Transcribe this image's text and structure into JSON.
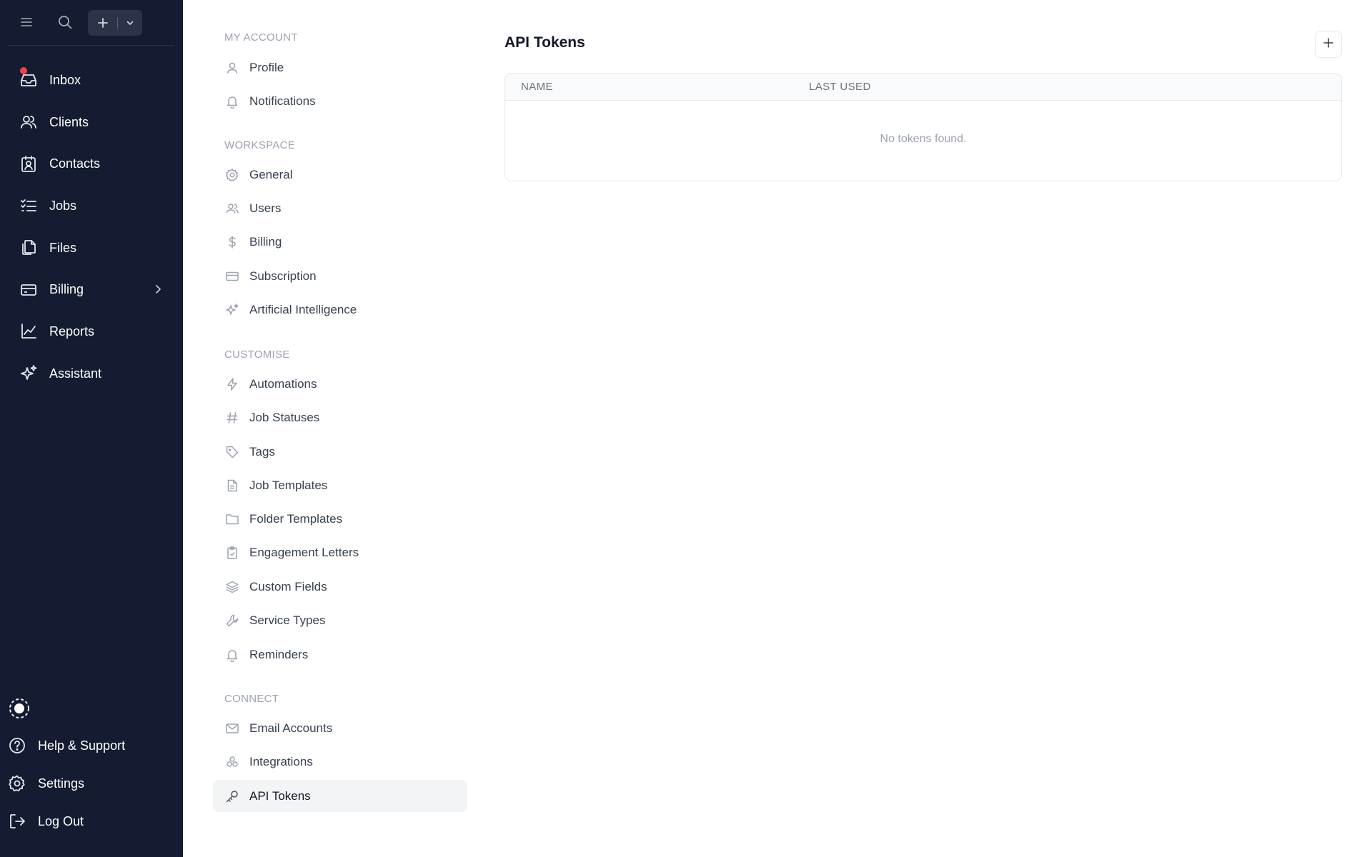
{
  "topbar": {
    "menu_icon": "menu-icon",
    "search_icon": "search-icon",
    "new_button_icon": "plus-icon",
    "new_dropdown_icon": "chevron-down-icon"
  },
  "main_nav": [
    {
      "label": "Inbox",
      "icon": "inbox-icon",
      "badge": true
    },
    {
      "label": "Clients",
      "icon": "users-icon"
    },
    {
      "label": "Contacts",
      "icon": "contact-card-icon"
    },
    {
      "label": "Jobs",
      "icon": "checklist-icon"
    },
    {
      "label": "Files",
      "icon": "files-icon"
    },
    {
      "label": "Billing",
      "icon": "credit-card-icon",
      "expandable": true
    },
    {
      "label": "Reports",
      "icon": "line-chart-icon"
    },
    {
      "label": "Assistant",
      "icon": "sparkles-icon"
    }
  ],
  "bottom_nav": {
    "help": "Help & Support",
    "settings": "Settings",
    "logout": "Log Out"
  },
  "subnav": {
    "my_account": {
      "title": "MY ACCOUNT",
      "items": [
        "Profile",
        "Notifications"
      ]
    },
    "workspace": {
      "title": "WORKSPACE",
      "items": [
        "General",
        "Users",
        "Billing",
        "Subscription",
        "Artificial Intelligence"
      ]
    },
    "customise": {
      "title": "CUSTOMISE",
      "items": [
        "Automations",
        "Job Statuses",
        "Tags",
        "Job Templates",
        "Folder Templates",
        "Engagement Letters",
        "Custom Fields",
        "Service Types",
        "Reminders"
      ]
    },
    "connect": {
      "title": "CONNECT",
      "items": [
        "Email Accounts",
        "Integrations",
        "API Tokens"
      ]
    },
    "active": "API Tokens"
  },
  "main": {
    "title": "API Tokens",
    "add_icon": "plus-icon",
    "table": {
      "columns": [
        "NAME",
        "LAST USED"
      ],
      "rows": [],
      "empty_message": "No tokens found."
    }
  },
  "colors": {
    "sidebar_bg": "#131c30",
    "badge": "#ef4444",
    "active_bg": "#f3f4f6"
  }
}
